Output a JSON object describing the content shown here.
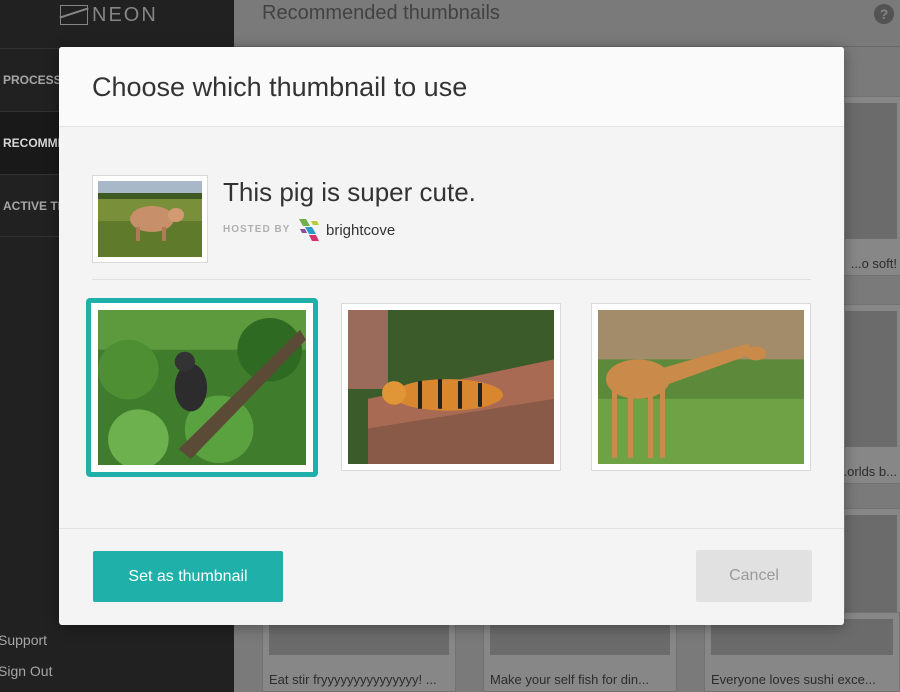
{
  "app": {
    "logo_text": "NEON"
  },
  "sidebar": {
    "items": [
      {
        "label": "PROCESSI",
        "active": false
      },
      {
        "label": "RECOMME",
        "active": true
      },
      {
        "label": "ACTIVE TE",
        "active": false
      }
    ],
    "support_label": "Support",
    "signout_label": "Sign Out"
  },
  "main": {
    "title": "Recommended thumbnails",
    "help_symbol": "?",
    "cards": [
      {
        "caption": "...o soft!"
      },
      {
        "caption": "...orlds b..."
      },
      {
        "caption": "Eat stir fryyyyyyyyyyyyyyy! ..."
      },
      {
        "caption": "Make your self fish for din..."
      },
      {
        "caption": "Everyone loves sushi exce..."
      }
    ]
  },
  "modal": {
    "title": "Choose which thumbnail to use",
    "video": {
      "title": "This pig is super cute.",
      "hosted_label": "HOSTED BY",
      "host_name": "brightcove"
    },
    "thumbnails": [
      {
        "subject": "gorilla",
        "selected": true
      },
      {
        "subject": "tiger",
        "selected": false
      },
      {
        "subject": "giraffe",
        "selected": false
      }
    ],
    "primary_button": "Set as thumbnail",
    "cancel_button": "Cancel"
  },
  "colors": {
    "accent": "#1fb0aa",
    "sidebar": "#222222",
    "cancel_bg": "#e1e1e1"
  }
}
